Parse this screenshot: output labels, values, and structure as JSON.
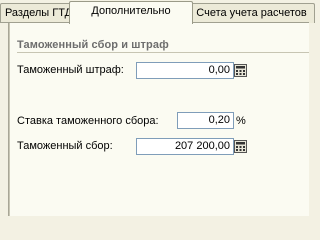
{
  "tabs": [
    {
      "label": "Разделы ГТД",
      "active": false
    },
    {
      "label": "Дополнительно",
      "active": true
    },
    {
      "label": "Счета учета расчетов",
      "active": false
    }
  ],
  "section": {
    "title": "Таможенный сбор и штраф"
  },
  "fields": {
    "penalty": {
      "label": "Таможенный штраф:",
      "value": "0,00"
    },
    "rate": {
      "label": "Ставка таможенного сбора:",
      "value": "0,20",
      "unit": "%"
    },
    "fee": {
      "label": "Таможенный сбор:",
      "value": "207 200,00"
    }
  },
  "colors": {
    "panel": "#fbfbf2",
    "background": "#f3f1e3",
    "section_title": "#6d6d6d",
    "field_border": "#7f9db9"
  },
  "icons": {
    "calculator": "calculator-icon"
  }
}
